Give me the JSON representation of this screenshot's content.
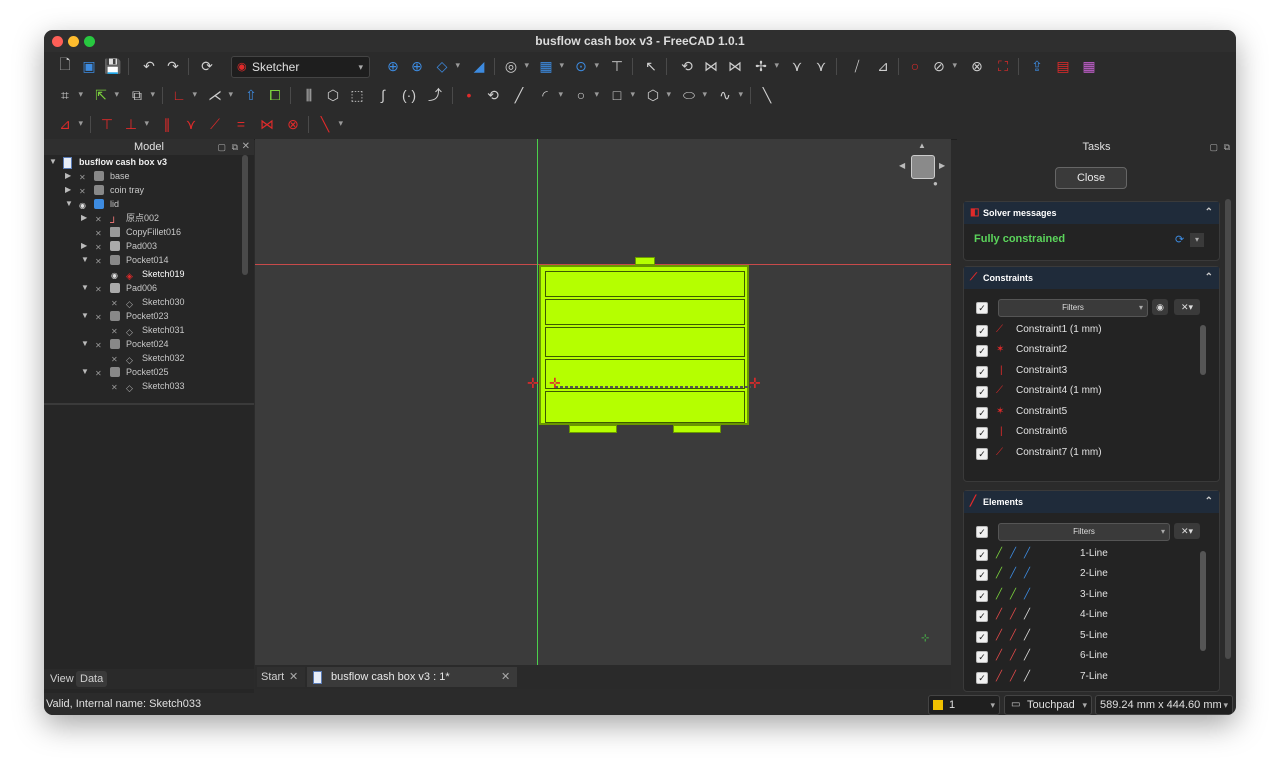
{
  "window": {
    "title": "busflow cash box v3 - FreeCAD 1.0.1"
  },
  "toolbar": {
    "workbench": "Sketcher"
  },
  "model_panel": {
    "title": "Model",
    "items": [
      {
        "label": "busflow cash box v3",
        "bold": true
      },
      {
        "label": "base"
      },
      {
        "label": "coin tray"
      },
      {
        "label": "lid"
      },
      {
        "label": "原点002"
      },
      {
        "label": "CopyFillet016"
      },
      {
        "label": "Pad003"
      },
      {
        "label": "Pocket014"
      },
      {
        "label": "Sketch019",
        "selected": true
      },
      {
        "label": "Pad006"
      },
      {
        "label": "Sketch030"
      },
      {
        "label": "Pocket023"
      },
      {
        "label": "Sketch031"
      },
      {
        "label": "Pocket024"
      },
      {
        "label": "Sketch032"
      },
      {
        "label": "Pocket025"
      },
      {
        "label": "Sketch033"
      }
    ],
    "tabs": [
      "View",
      "Data"
    ]
  },
  "viewport_tabs": [
    {
      "label": "Start"
    },
    {
      "label": "busflow cash box v3 : 1*"
    }
  ],
  "tasks": {
    "title": "Tasks",
    "close_label": "Close",
    "solver": {
      "header": "Solver messages",
      "status": "Fully constrained"
    },
    "constraints": {
      "header": "Constraints",
      "filter_label": "Filters",
      "items": [
        "Constraint1 (1 mm)",
        "Constraint2",
        "Constraint3",
        "Constraint4 (1 mm)",
        "Constraint5",
        "Constraint6",
        "Constraint7 (1 mm)"
      ]
    },
    "elements": {
      "header": "Elements",
      "filter_label": "Filters",
      "items": [
        "1-Line",
        "2-Line",
        "3-Line",
        "4-Line",
        "5-Line",
        "6-Line",
        "7-Line"
      ]
    }
  },
  "statusbar": {
    "message": "Valid, Internal name: Sketch033",
    "layer": "1",
    "navigation": "Touchpad",
    "dimensions": "589.24 mm x 444.60 mm"
  },
  "colors": {
    "sketch_fill": "#b5ff00",
    "axis_x": "#d04a4a",
    "axis_y": "#4bd04b",
    "solver_ok": "#5bd45b"
  }
}
